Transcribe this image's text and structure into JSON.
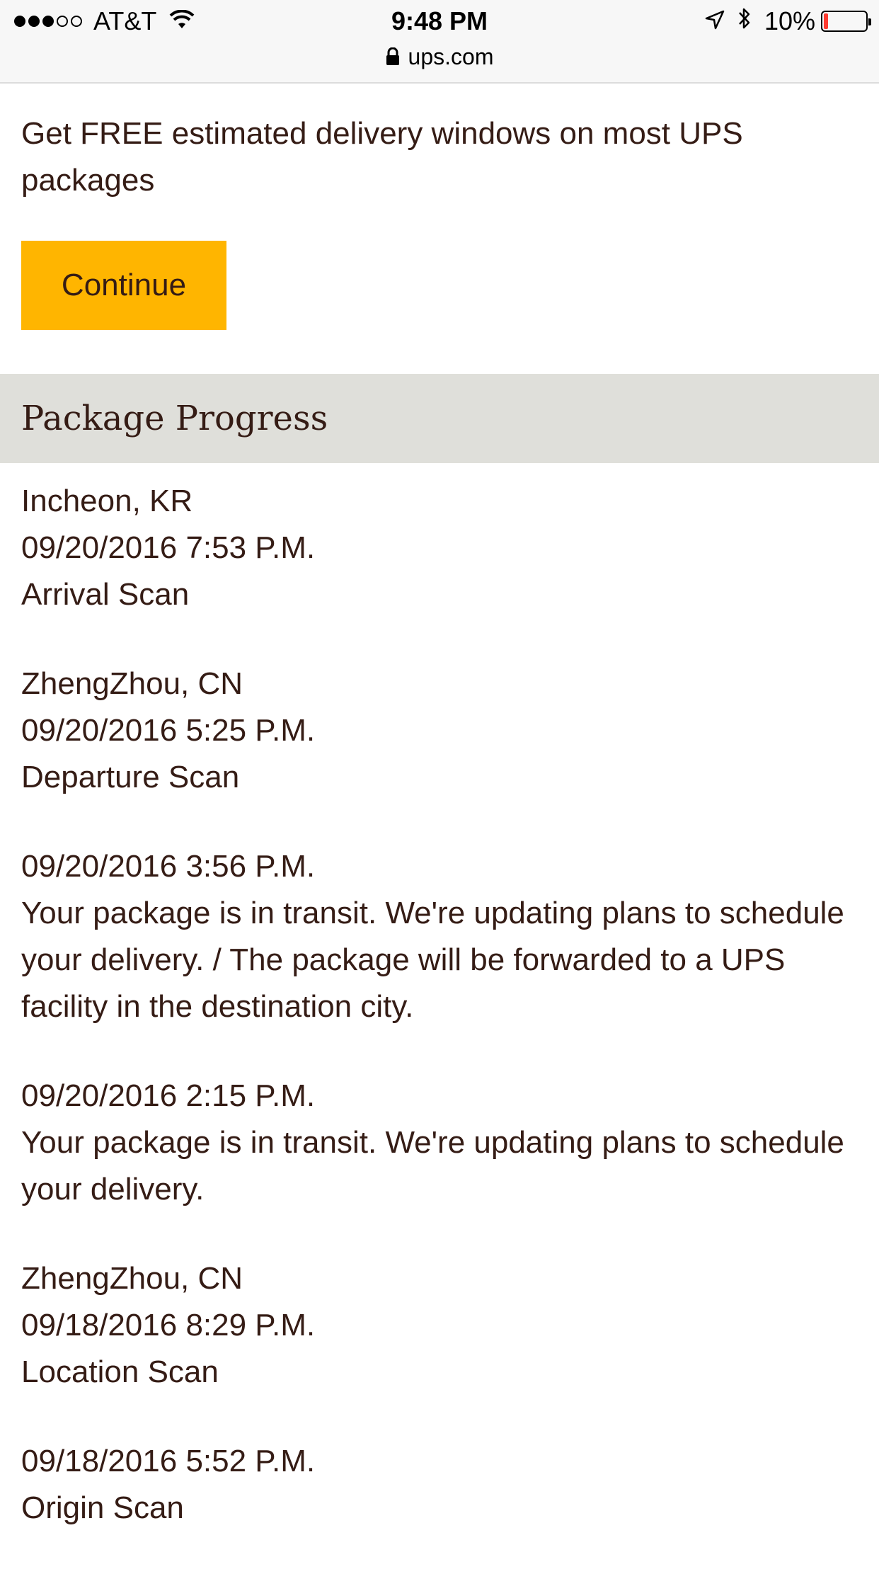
{
  "status_bar": {
    "carrier": "AT&T",
    "time": "9:48 PM",
    "battery": "10%",
    "battery_level": 0.1,
    "url": "ups.com"
  },
  "promo": {
    "text": "Get FREE estimated delivery windows on most UPS packages",
    "button_label": "Continue",
    "button_color": "#ffb500"
  },
  "package_progress": {
    "title": "Package Progress",
    "entries": [
      {
        "location": "Incheon, KR",
        "datetime": "09/20/2016 7:53 P.M.",
        "activity": "Arrival Scan"
      },
      {
        "location": "ZhengZhou, CN",
        "datetime": "09/20/2016 5:25 P.M.",
        "activity": "Departure Scan"
      },
      {
        "location": "",
        "datetime": "09/20/2016 3:56 P.M.",
        "activity": "Your package is in transit. We're updating plans to schedule your delivery. / The package will be forwarded to a UPS facility in the destination city."
      },
      {
        "location": "",
        "datetime": "09/20/2016 2:15 P.M.",
        "activity": "Your package is in transit. We're updating plans to schedule your delivery."
      },
      {
        "location": "ZhengZhou, CN",
        "datetime": "09/18/2016 8:29 P.M.",
        "activity": "Location Scan"
      },
      {
        "location": "",
        "datetime": "09/18/2016 5:52 P.M.",
        "activity": "Origin Scan"
      }
    ]
  }
}
